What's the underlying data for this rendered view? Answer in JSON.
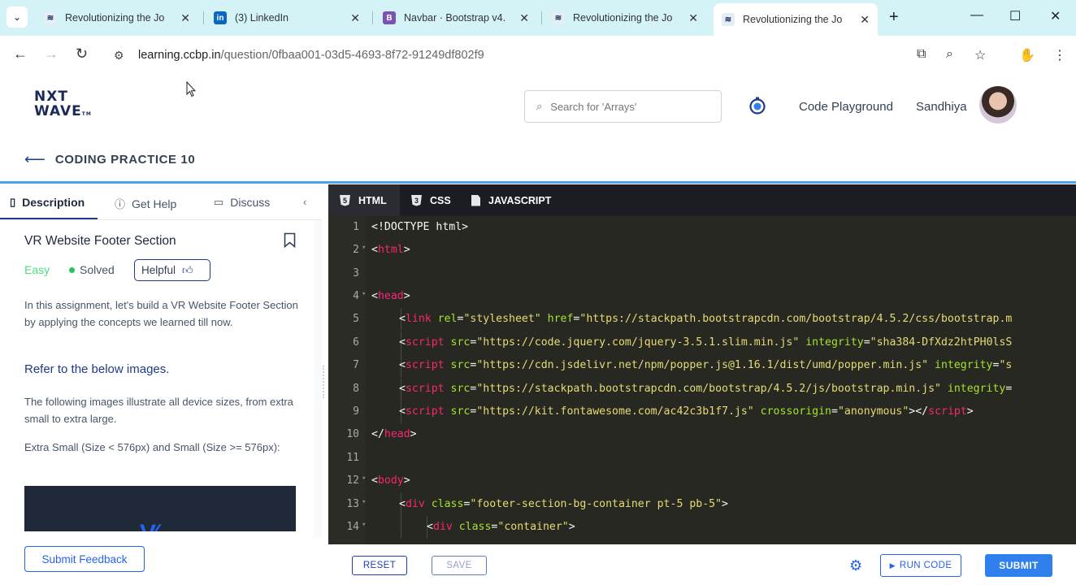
{
  "browser": {
    "tabs": [
      {
        "title": "Revolutionizing the Jo",
        "favicon": "ccbp-favicon"
      },
      {
        "title": "(3) LinkedIn",
        "favicon": "linkedin-favicon"
      },
      {
        "title": "Navbar · Bootstrap v4.",
        "favicon": "bootstrap-favicon"
      },
      {
        "title": "Revolutionizing the Jo",
        "favicon": "ccbp-favicon"
      },
      {
        "title": "Revolutionizing the Jo",
        "favicon": "ccbp-favicon"
      }
    ],
    "active_tab_index": 4,
    "url_host": "learning.ccbp.in",
    "url_path": "/question/0fbaa001-03d5-4693-8f72-91249df802f9"
  },
  "header": {
    "logo_line1": "NXT",
    "logo_line2": "WAVE",
    "logo_tm": "TM",
    "search_placeholder": "Search for 'Arrays'",
    "code_playground": "Code Playground",
    "username": "Sandhiya"
  },
  "page": {
    "title": "CODING PRACTICE 10"
  },
  "left_panel": {
    "tabs": [
      {
        "label": "Description",
        "icon": "file-icon"
      },
      {
        "label": "Get Help",
        "icon": "help-circle-icon"
      },
      {
        "label": "Discuss",
        "icon": "chat-icon"
      }
    ],
    "problem_title": "VR Website Footer Section",
    "difficulty": "Easy",
    "status": "Solved",
    "helpful_label": "Helpful",
    "intro": "In this assignment, let's build a VR Website Footer Section by applying the concepts we learned till now.",
    "refer": "Refer to the below images.",
    "device_sizes": "The following images illustrate all device sizes, from extra small to extra large.",
    "size_caption": "Extra Small (Size < 576px) and Small (Size >= 576px):",
    "feedback_label": "Submit Feedback"
  },
  "editor": {
    "tabs": [
      "HTML",
      "CSS",
      "JAVASCRIPT"
    ],
    "active_tab": "HTML",
    "line_numbers": [
      "1",
      "2",
      "3",
      "4",
      "5",
      "6",
      "7",
      "8",
      "9",
      "10",
      "11",
      "12",
      "13",
      "14"
    ],
    "lines": {
      "l1": {
        "p1": "<!DOCTYPE html>"
      },
      "l2": {
        "p1": "<",
        "t1": "html",
        "p2": ">"
      },
      "l4": {
        "p1": "<",
        "t1": "head",
        "p2": ">"
      },
      "l5": {
        "p1": "<",
        "t1": "link",
        "a1": " rel",
        "p2": "=",
        "s1": "\"stylesheet\"",
        "a2": " href",
        "p3": "=",
        "s2": "\"https://stackpath.bootstrapcdn.com/bootstrap/4.5.2/css/bootstrap.m"
      },
      "l6": {
        "p1": "<",
        "t1": "script",
        "a1": " src",
        "p2": "=",
        "s1": "\"https://code.jquery.com/jquery-3.5.1.slim.min.js\"",
        "a2": " integrity",
        "p3": "=",
        "s2": "\"sha384-DfXdz2htPH0lsS"
      },
      "l7": {
        "p1": "<",
        "t1": "script",
        "a1": " src",
        "p2": "=",
        "s1": "\"https://cdn.jsdelivr.net/npm/popper.js@1.16.1/dist/umd/popper.min.js\"",
        "a2": " integrity",
        "p3": "=",
        "s2": "\"s"
      },
      "l8": {
        "p1": "<",
        "t1": "script",
        "a1": " src",
        "p2": "=",
        "s1": "\"https://stackpath.bootstrapcdn.com/bootstrap/4.5.2/js/bootstrap.min.js\"",
        "a2": " integrity",
        "p3": "="
      },
      "l9": {
        "p1": "<",
        "t1": "script",
        "a1": " src",
        "p2": "=",
        "s1": "\"https://kit.fontawesome.com/ac42c3b1f7.js\"",
        "a2": " crossorigin",
        "p3": "=",
        "s2": "\"anonymous\"",
        "p4": "></",
        "t2": "script",
        "p5": ">"
      },
      "l10": {
        "p1": "</",
        "t1": "head",
        "p2": ">"
      },
      "l12": {
        "p1": "<",
        "t1": "body",
        "p2": ">"
      },
      "l13": {
        "p1": "<",
        "t1": "div",
        "a1": " class",
        "p2": "=",
        "s1": "\"footer-section-bg-container pt-5 pb-5\"",
        "p3": ">"
      },
      "l14": {
        "p1": "<",
        "t1": "div",
        "a1": " class",
        "p2": "=",
        "s1": "\"container\"",
        "p3": ">"
      }
    }
  },
  "footer": {
    "reset": "RESET",
    "save": "SAVE",
    "run": "RUN CODE",
    "submit": "SUBMIT"
  },
  "colors": {
    "tabbar_bg": "#d3f3f7",
    "brand_blue": "#2f80ed",
    "editor_bg": "#272822",
    "tag": "#f92672",
    "attr": "#a6e22e",
    "string": "#e6db74"
  }
}
